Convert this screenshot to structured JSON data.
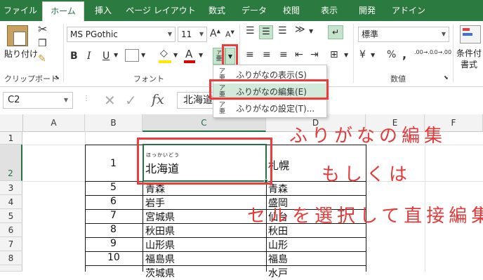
{
  "tabs": [
    "ファイル",
    "ホーム",
    "挿入",
    "ページ レイアウト",
    "数式",
    "データ",
    "校閲",
    "表示",
    "開発",
    "アドイン"
  ],
  "ribbon": {
    "paste_label": "貼り付け",
    "clipboard_label": "クリップボード",
    "font_name": "MS PGothic",
    "font_size": "11",
    "font_label": "フォント",
    "bold": "B",
    "italic": "I",
    "underline": "U",
    "font_color_glyph": "A",
    "number_format": "標準",
    "number_label": "数値",
    "percent": "%",
    "comma": ",",
    "conditional_label_1": "条件付",
    "conditional_label_2": "書式",
    "furigana_glyph_top": "ア",
    "furigana_glyph_bottom": "亜",
    "dec_inc": ".00→.0",
    "dec_dec": ".0→.00",
    "currency": "¥",
    "grow_font": "A",
    "shrink_font": "A"
  },
  "menu": {
    "items": [
      "ふりがなの表示(S)",
      "ふりがなの編集(E)",
      "ふりがなの設定(T)..."
    ]
  },
  "formula_bar": {
    "name_box": "C2",
    "fx": "fx",
    "value": "北海道"
  },
  "columns": [
    "A",
    "B",
    "C",
    "D",
    "E",
    "F"
  ],
  "rows": [
    "1",
    "2",
    "3",
    "4",
    "5",
    "6",
    "7",
    "8"
  ],
  "table": [
    {
      "b": "1",
      "c": "北海道",
      "d": "札幌",
      "ruby": "ほっかいどう"
    },
    {
      "b": "5",
      "c": "青森",
      "d": "青森"
    },
    {
      "b": "6",
      "c": "岩手",
      "d": "盛岡"
    },
    {
      "b": "7",
      "c": "宮城県",
      "d": "仙台"
    },
    {
      "b": "8",
      "c": "秋田県",
      "d": "秋田"
    },
    {
      "b": "9",
      "c": "山形県",
      "d": "山形"
    },
    {
      "b": "10",
      "c": "福島県",
      "d": "福島"
    },
    {
      "b": "",
      "c": "茨城県",
      "d": "水戸"
    }
  ],
  "annotations": [
    "ふりがなの編集",
    "もしくは",
    "セルを選択して直接編集"
  ],
  "colors": {
    "accent": "#217346",
    "tabbar": "#2b7a3f",
    "annotation": "#e53a3a",
    "menu_highlight": "#d3eadb"
  }
}
